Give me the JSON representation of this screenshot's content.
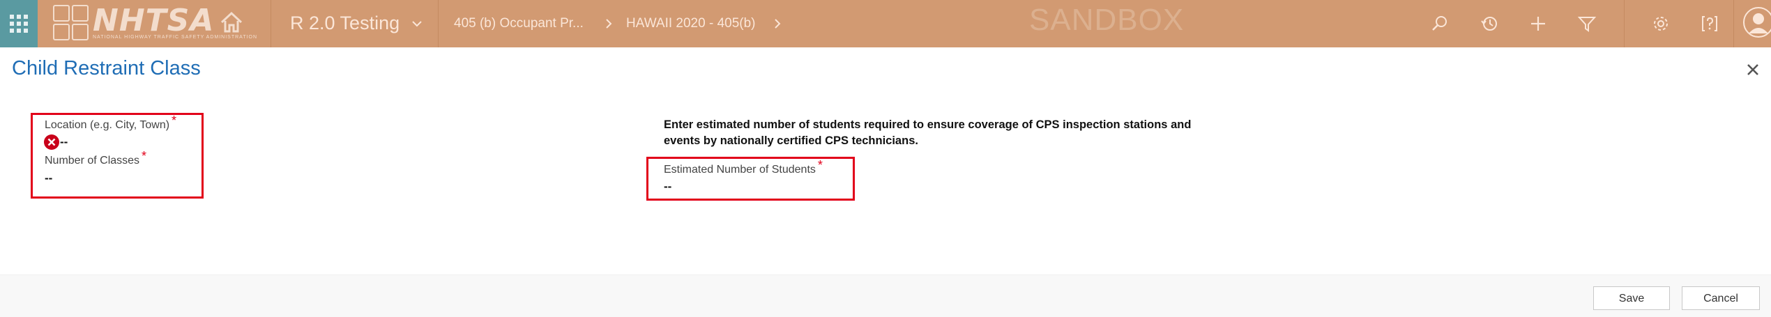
{
  "topbar": {
    "logo_text": "NHTSA",
    "logo_subtext": "NATIONAL HIGHWAY TRAFFIC SAFETY ADMINISTRATION",
    "app_name": "R 2.0 Testing",
    "breadcrumbs": [
      {
        "label": "405 (b) Occupant Pr..."
      },
      {
        "label": "HAWAII 2020 - 405(b)"
      }
    ],
    "environment_label": "SANDBOX",
    "commands": [
      "search-icon",
      "history-icon",
      "add-icon",
      "filter-icon",
      "settings-icon",
      "help-icon"
    ],
    "colors": {
      "bar": "#d29a72",
      "waffle": "#5a9aa1"
    }
  },
  "dialog": {
    "title": "Child Restraint Class",
    "close_icon": "close-icon"
  },
  "form": {
    "location": {
      "label": "Location (e.g. City, Town)",
      "required_marker": "*",
      "value": "--",
      "status_icon": "error-icon"
    },
    "number_of_classes": {
      "label": "Number of Classes",
      "required_marker": "*",
      "value": "--"
    },
    "instructions": "Enter estimated number of students required to ensure coverage of CPS inspection stations and events by nationally certified CPS technicians.",
    "estimated_students": {
      "label": "Estimated Number of Students",
      "required_marker": "*",
      "value": "--"
    },
    "highlight_color": "#e2001a"
  },
  "footer": {
    "save_label": "Save",
    "cancel_label": "Cancel"
  }
}
